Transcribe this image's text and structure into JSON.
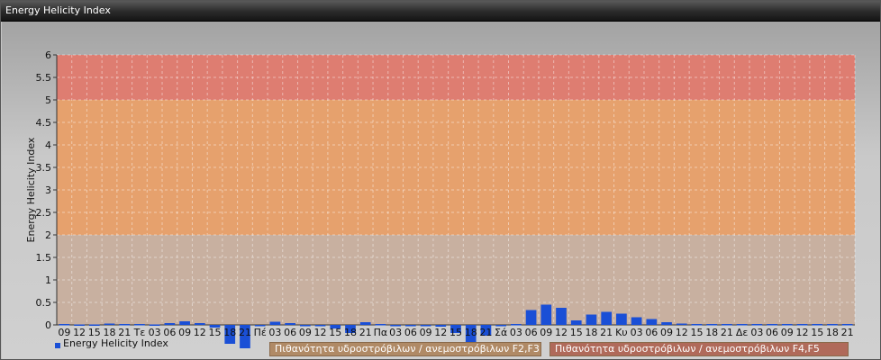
{
  "window": {
    "title": "Energy Helicity Index"
  },
  "colors": {
    "bar": "#1a4fd6",
    "band_low": "#c8b0a0",
    "band_mid": "#e8a068",
    "band_high": "#e0786c"
  },
  "chart_data": {
    "type": "bar",
    "title": "",
    "xlabel": "",
    "ylabel": "Energy Helicity Index",
    "ylim": [
      0,
      6
    ],
    "yticks": [
      "0",
      "0.5",
      "1",
      "1.5",
      "2",
      "2.5",
      "3",
      "3.5",
      "4",
      "4.5",
      "5",
      "5.5",
      "6"
    ],
    "grid": true,
    "legend": "bottom-left",
    "categories": [
      "09",
      "12",
      "15",
      "18",
      "21",
      "Τε",
      "03",
      "06",
      "09",
      "12",
      "15",
      "18",
      "21",
      "Πέ",
      "03",
      "06",
      "09",
      "12",
      "15",
      "18",
      "21",
      "Πα",
      "03",
      "06",
      "09",
      "12",
      "15",
      "18",
      "21",
      "Σά",
      "03",
      "06",
      "09",
      "12",
      "15",
      "18",
      "21",
      "Κυ",
      "03",
      "06",
      "09",
      "12",
      "15",
      "18",
      "21",
      "Δε",
      "03",
      "06",
      "09",
      "12",
      "15",
      "18",
      "21"
    ],
    "series": [
      {
        "name": "Energy Helicity Index",
        "values": [
          0.02,
          0.01,
          0.01,
          0.03,
          0.02,
          0.02,
          0.01,
          0.04,
          0.08,
          0.04,
          -0.06,
          -0.42,
          -0.52,
          -0.03,
          0.07,
          0.04,
          -0.02,
          -0.03,
          -0.08,
          -0.18,
          0.06,
          0.02,
          -0.02,
          -0.02,
          -0.03,
          -0.04,
          -0.18,
          -0.42,
          -0.24,
          -0.03,
          0.02,
          0.33,
          0.45,
          0.38,
          0.1,
          0.23,
          0.29,
          0.25,
          0.17,
          0.13,
          0.06,
          0.03,
          0.02,
          0.02,
          0.02,
          0.02,
          0.02,
          0.02,
          0.02,
          0.02,
          0.02,
          0.02,
          0.02
        ]
      }
    ],
    "bands": [
      {
        "from": 2,
        "to": 5,
        "label": "Πιθανότητα υδροστρόβιλων / ανεμοστρόβιλων F2,F3"
      },
      {
        "from": 5,
        "to": 6,
        "label": "Πιθανότητα υδροστρόβιλων / ανεμοστρόβιλων F4,F5"
      }
    ]
  }
}
